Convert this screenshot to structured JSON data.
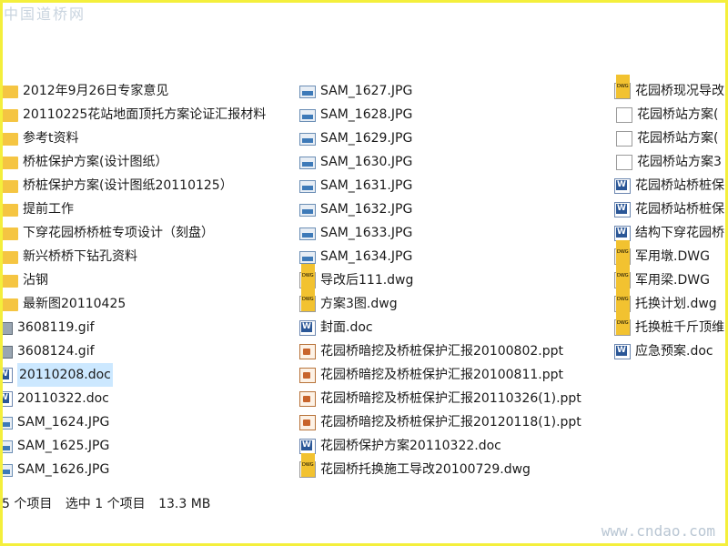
{
  "watermark": {
    "top": "中国道桥网",
    "bottom": "www.cndao.com"
  },
  "columns": [
    [
      {
        "name": "2012年9月26日专家意见",
        "type": "folder"
      },
      {
        "name": "20110225花站地面顶托方案论证汇报材料",
        "type": "folder"
      },
      {
        "name": "参考t资料",
        "type": "folder"
      },
      {
        "name": "桥桩保护方案(设计图纸）",
        "type": "folder"
      },
      {
        "name": "桥桩保护方案(设计图纸20110125）",
        "type": "folder"
      },
      {
        "name": "提前工作",
        "type": "folder"
      },
      {
        "name": "下穿花园桥桥桩专项设计（刻盘）",
        "type": "folder"
      },
      {
        "name": "新兴桥桥下钻孔资料",
        "type": "folder"
      },
      {
        "name": "沾钢",
        "type": "folder"
      },
      {
        "name": "最新图20110425",
        "type": "folder"
      },
      {
        "name": "3608119.gif",
        "type": "gif"
      },
      {
        "name": "3608124.gif",
        "type": "gif"
      },
      {
        "name": "20110208.doc",
        "type": "doc",
        "selected": true
      },
      {
        "name": "20110322.doc",
        "type": "doc"
      },
      {
        "name": "SAM_1624.JPG",
        "type": "img"
      },
      {
        "name": "SAM_1625.JPG",
        "type": "img"
      },
      {
        "name": "SAM_1626.JPG",
        "type": "img"
      }
    ],
    [
      {
        "name": "SAM_1627.JPG",
        "type": "img"
      },
      {
        "name": "SAM_1628.JPG",
        "type": "img"
      },
      {
        "name": "SAM_1629.JPG",
        "type": "img"
      },
      {
        "name": "SAM_1630.JPG",
        "type": "img"
      },
      {
        "name": "SAM_1631.JPG",
        "type": "img"
      },
      {
        "name": "SAM_1632.JPG",
        "type": "img"
      },
      {
        "name": "SAM_1633.JPG",
        "type": "img"
      },
      {
        "name": "SAM_1634.JPG",
        "type": "img"
      },
      {
        "name": "导改后111.dwg",
        "type": "dwg"
      },
      {
        "name": "方案3图.dwg",
        "type": "dwg"
      },
      {
        "name": "封面.doc",
        "type": "doc"
      },
      {
        "name": "花园桥暗挖及桥桩保护汇报20100802.ppt",
        "type": "ppt"
      },
      {
        "name": "花园桥暗挖及桥桩保护汇报20100811.ppt",
        "type": "ppt"
      },
      {
        "name": "花园桥暗挖及桥桩保护汇报20110326(1).ppt",
        "type": "ppt"
      },
      {
        "name": "花园桥暗挖及桥桩保护汇报20120118(1).ppt",
        "type": "ppt"
      },
      {
        "name": "花园桥保护方案20110322.doc",
        "type": "doc"
      },
      {
        "name": "花园桥托换施工导改20100729.dwg",
        "type": "dwg"
      }
    ],
    [
      {
        "name": "花园桥现况导改",
        "type": "dwg"
      },
      {
        "name": "花园桥站方案(",
        "type": "file"
      },
      {
        "name": "花园桥站方案(",
        "type": "file"
      },
      {
        "name": "花园桥站方案3",
        "type": "file"
      },
      {
        "name": "花园桥站桥桩保",
        "type": "doc"
      },
      {
        "name": "花园桥站桥桩保",
        "type": "doc"
      },
      {
        "name": "结构下穿花园桥",
        "type": "doc"
      },
      {
        "name": "军用墩.DWG",
        "type": "dwg"
      },
      {
        "name": "军用梁.DWG",
        "type": "dwg"
      },
      {
        "name": "托换计划.dwg",
        "type": "dwg"
      },
      {
        "name": "托换桩千斤顶维",
        "type": "dwg"
      },
      {
        "name": "应急预案.doc",
        "type": "doc"
      }
    ]
  ],
  "status": {
    "count": "5 个项目",
    "selected": "选中 1 个项目",
    "size": "13.3 MB"
  }
}
